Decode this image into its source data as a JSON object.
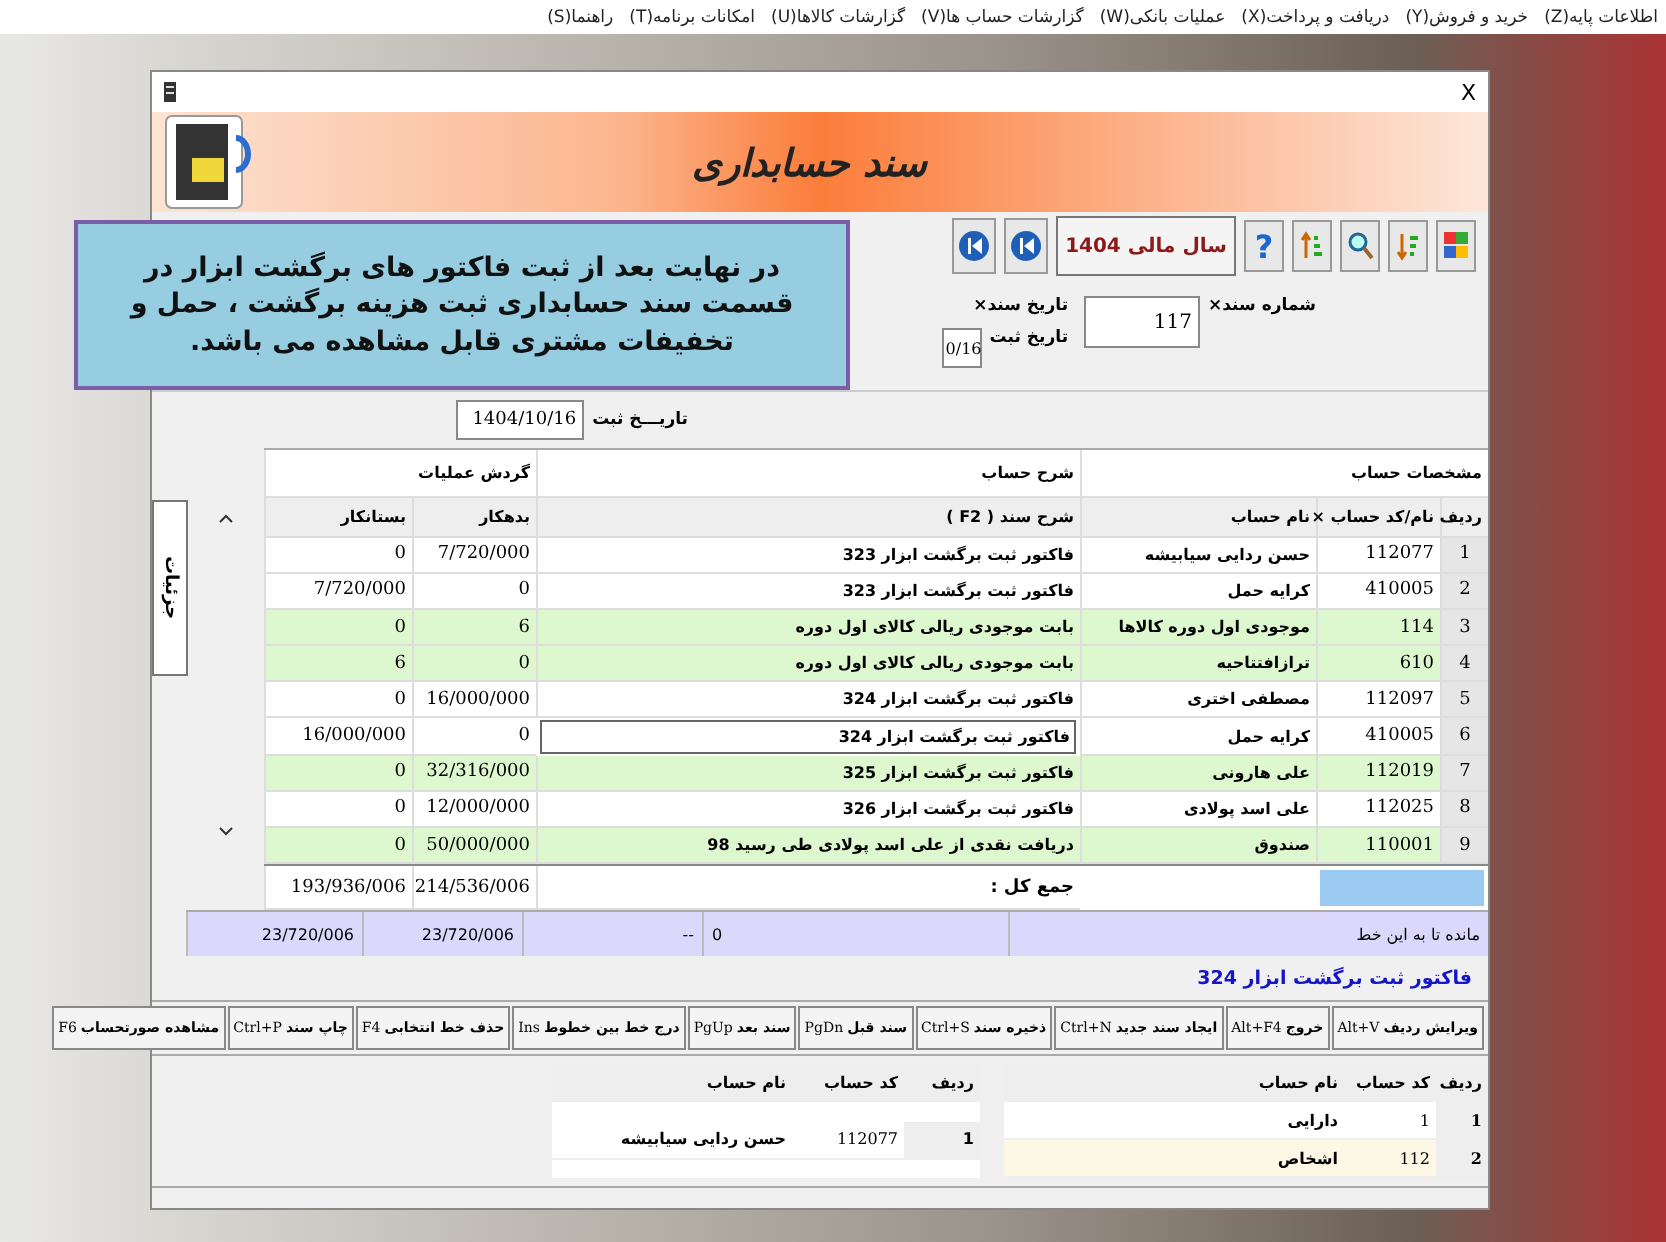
{
  "menu_bar": [
    "اطلاعات پایه(Z)",
    "خرید و فروش(Y)",
    "دریافت و پرداخت(X)",
    "عملیات بانکی(W)",
    "گزارشات حساب ها(V)",
    "گزارشات کالاها(U)",
    "امکانات برنامه(T)",
    "راهنما(S)"
  ],
  "window": {
    "title": "سند حسابداری",
    "close": "X"
  },
  "toolbar": {
    "fiscal_year": "سال مالی 1404",
    "help": "?"
  },
  "form": {
    "doc_number_label": "شماره سند×",
    "doc_number": "117",
    "doc_date_label": "تاریخ سند×",
    "reg_date_label": "تاریخ ثبت",
    "reg_date_partial": "0/16",
    "reg_date2_label": "تاریـــخ ثبت",
    "reg_date2": "1404/10/16"
  },
  "callout": "در نهایت بعد از ثبت فاکتور  های برگشت ابزار در قسمت سند حسابداری ثبت هزینه برگشت ، حمل و تخفیفات مشتری قابل مشاهده می باشد.",
  "side_tab": "جزئیات",
  "table": {
    "groups": [
      "مشخصات حساب",
      "شرح حساب",
      "گردش عملیات"
    ],
    "columns": [
      "ردیف",
      "نام/کد حساب ×",
      "نام حساب",
      "شرح سند ( F2 )",
      "بدهکار",
      "بستانکار"
    ],
    "rows": [
      {
        "index": "1",
        "code": "112077",
        "name": "حسن ردایی سیابیشه",
        "desc": "فاکتور ثبت برگشت ابزار 323",
        "debit": "7/720/000",
        "credit": "0",
        "highlighted": false,
        "editing": false
      },
      {
        "index": "2",
        "code": "410005",
        "name": "کرایه حمل",
        "desc": "فاکتور ثبت برگشت ابزار 323",
        "debit": "0",
        "credit": "7/720/000",
        "highlighted": false,
        "editing": false
      },
      {
        "index": "3",
        "code": "114",
        "name": "موجودی اول دوره کالاها",
        "desc": "بابت موجودی ریالی کالای اول دوره",
        "debit": "6",
        "credit": "0",
        "highlighted": true,
        "editing": false
      },
      {
        "index": "4",
        "code": "610",
        "name": "ترازافتتاحیه",
        "desc": "بابت موجودی ریالی کالای اول دوره",
        "debit": "0",
        "credit": "6",
        "highlighted": true,
        "editing": false
      },
      {
        "index": "5",
        "code": "112097",
        "name": "مصطفی اختری",
        "desc": "فاکتور ثبت برگشت ابزار 324",
        "debit": "16/000/000",
        "credit": "0",
        "highlighted": false,
        "editing": false
      },
      {
        "index": "6",
        "code": "410005",
        "name": "کرایه حمل",
        "desc": "فاکتور ثبت برگشت ابزار 324",
        "debit": "0",
        "credit": "16/000/000",
        "highlighted": false,
        "editing": true
      },
      {
        "index": "7",
        "code": "112019",
        "name": "علی هارونی",
        "desc": "فاکتور ثبت برگشت ابزار 325",
        "debit": "32/316/000",
        "credit": "0",
        "highlighted": true,
        "editing": false
      },
      {
        "index": "8",
        "code": "112025",
        "name": "علی اسد پولادی",
        "desc": "فاکتور ثبت برگشت ابزار 326",
        "debit": "12/000/000",
        "credit": "0",
        "highlighted": false,
        "editing": false
      },
      {
        "index": "9",
        "code": "110001",
        "name": "صندوق",
        "desc": "دریافت نقدی از علی اسد پولادی طی رسید 98",
        "debit": "50/000/000",
        "credit": "0",
        "highlighted": true,
        "editing": false
      }
    ],
    "total_label": "جمع کل :",
    "total_debit": "214/536/006",
    "total_credit": "193/936/006"
  },
  "balance_row": {
    "label": "مانده تا به این خط",
    "value_1": "0",
    "value_2": "--",
    "value_3": "23/720/006",
    "value_4": "23/720/006"
  },
  "description": "فاکتور ثبت برگشت ابزار 324",
  "buttons": [
    {
      "label": "ویرایش ردیف",
      "key": "Alt+V"
    },
    {
      "label": "خروج",
      "key": "Alt+F4"
    },
    {
      "label": "ایجاد سند جدید",
      "key": "Ctrl+N"
    },
    {
      "label": "ذخیره سند",
      "key": "Ctrl+S"
    },
    {
      "label": "سند قبل",
      "key": "PgDn"
    },
    {
      "label": "سند بعد",
      "key": "PgUp"
    },
    {
      "label": "درج خط بین خطوط",
      "key": "Ins"
    },
    {
      "label": "حذف خط انتخابی",
      "key": "F4"
    },
    {
      "label": "چاپ سند",
      "key": "Ctrl+P"
    },
    {
      "label": "مشاهده صورتحساب",
      "key": "F6"
    }
  ],
  "account_tree": {
    "columns": [
      "ردیف",
      "کد حساب",
      "نام حساب"
    ],
    "rows": [
      {
        "index": "1",
        "code": "1",
        "name": "دارایی",
        "selected": false
      },
      {
        "index": "2",
        "code": "112",
        "name": "اشخاص",
        "selected": true
      }
    ]
  },
  "account_list": {
    "columns": [
      "ردیف",
      "کد حساب",
      "نام حساب"
    ],
    "rows": [
      {
        "index": "1",
        "code": "112077",
        "name": "حسن ردایی سیابیشه"
      }
    ]
  }
}
